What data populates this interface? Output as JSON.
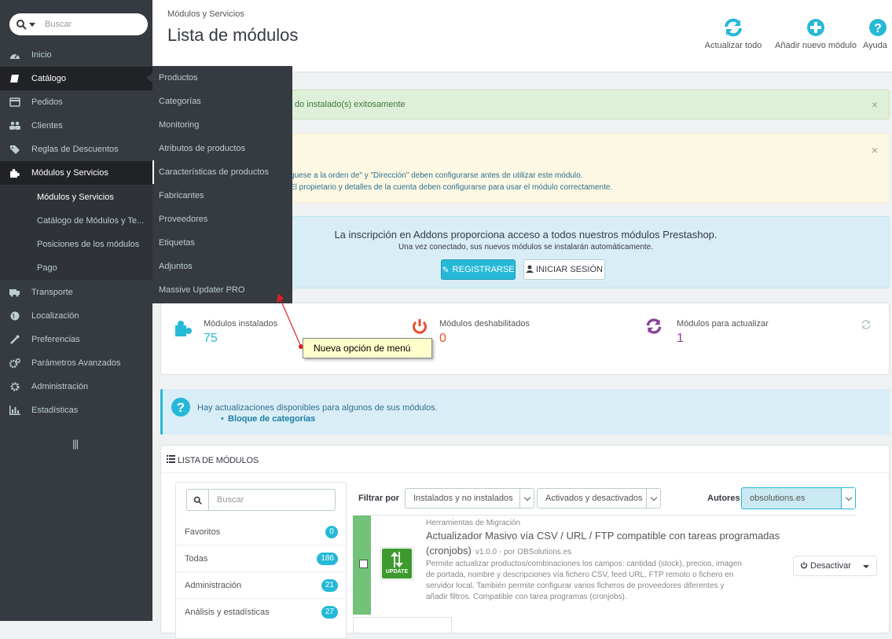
{
  "sidebar": {
    "search_placeholder": "Buscar",
    "items": [
      {
        "label": "Inicio",
        "icon": "dashboard-icon"
      },
      {
        "label": "Catálogo",
        "icon": "book-icon"
      },
      {
        "label": "Pedidos",
        "icon": "credit-card-icon"
      },
      {
        "label": "Clientes",
        "icon": "users-icon"
      },
      {
        "label": "Reglas de Descuentos",
        "icon": "tag-icon"
      },
      {
        "label": "Módulos y Servicios",
        "icon": "puzzle-icon"
      },
      {
        "label": "Transporte",
        "icon": "truck-icon"
      },
      {
        "label": "Localización",
        "icon": "globe-icon"
      },
      {
        "label": "Preferencias",
        "icon": "wrench-icon"
      },
      {
        "label": "Parámetros Avanzados",
        "icon": "cogs-icon"
      },
      {
        "label": "Administración",
        "icon": "cog-icon"
      },
      {
        "label": "Estadísticas",
        "icon": "bar-chart-icon"
      }
    ],
    "submenu": [
      {
        "label": "Módulos y Servicios"
      },
      {
        "label": "Catálogo de Módulos y Te..."
      },
      {
        "label": "Posiciones de los módulos"
      },
      {
        "label": "Pago"
      }
    ],
    "collapse_icon": "|||"
  },
  "flyout": {
    "items": [
      {
        "label": "Productos"
      },
      {
        "label": "Categorías"
      },
      {
        "label": "Monitoring"
      },
      {
        "label": "Atributos de productos"
      },
      {
        "label": "Características de productos"
      },
      {
        "label": "Fabricantes"
      },
      {
        "label": "Proveedores"
      },
      {
        "label": "Etiquetas"
      },
      {
        "label": "Adjuntos"
      },
      {
        "label": "Massive Updater PRO"
      }
    ]
  },
  "header": {
    "breadcrumb": "Módulos y Servicios",
    "title": "Lista de módulos",
    "toolbar": [
      {
        "label": "Actualizar todo",
        "icon": "refresh-icon"
      },
      {
        "label": "Añadir nuevo módulo",
        "icon": "plus-circle-icon"
      },
      {
        "label": "Ayuda",
        "icon": "question-circle-icon"
      }
    ]
  },
  "alerts": {
    "success_text": "do instalado(s) exitosamente",
    "warning_line1": "guese a la orden de\" y \"Dirección\" deben configurarse antes de utilizar este módulo.",
    "warning_line2": "El propietario y detalles de la cuenta deben configurarse para usar el módulo correctamente.",
    "close": "×"
  },
  "addons": {
    "title": "La inscripción en Addons proporciona acceso a todos nuestros módulos Prestashop.",
    "subtitle": "Una vez conectado, sus nuevos módulos se instalarán automáticamente.",
    "register_label": "REGISTRARSE",
    "login_label": "INICIAR SESIÓN"
  },
  "kpis": [
    {
      "label": "Módulos instalados",
      "value": "75"
    },
    {
      "label": "Módulos deshabilitados",
      "value": "0"
    },
    {
      "label": "Módulos para actualizar",
      "value": "1"
    }
  ],
  "tooltip": "Nueva opción de menú",
  "updates": {
    "text": "Hay actualizaciones disponibles para algunos de sus módulos.",
    "item": "Bloque de categorías"
  },
  "modules_panel": {
    "heading": "LISTA DE MÓDULOS",
    "search_placeholder": "Buscar",
    "categories": [
      {
        "label": "Favoritos",
        "count": "0"
      },
      {
        "label": "Todas",
        "count": "186"
      },
      {
        "label": "Administración",
        "count": "21"
      },
      {
        "label": "Análisis y estadísticas",
        "count": "27"
      }
    ],
    "filter_label": "Filtrar por",
    "filter_install": "Instalados y no instalados",
    "filter_enable": "Activados y desactivados",
    "authors_label": "Autores",
    "authors_value": "obsolutions.es"
  },
  "module": {
    "category": "Herramientas de Migración",
    "name_line1": "Actualizador Masivo vía CSV / URL / FTP compatible con tareas programadas",
    "name_line2": "(cronjobs)",
    "version": "v1.0.0 - por OBSolutions.es",
    "desc_line1": "Permite actualizar productos/combinaciones los campos: cantidad (stock), precios, imagen",
    "desc_line2": "de portada, nombre y descripciones vía fichero CSV, feed URL, FTP remoto o fichero en",
    "desc_line3": "servidor local. También permite configurar varios ficheros de proveedores diferentes y",
    "desc_line4": "añadir filtros. Compatible con tarea programas (cronjobs).",
    "icon_label": "UPDATE",
    "action_label": "Desactivar"
  },
  "colors": {
    "sidebar_bg": "#363a41",
    "accent": "#25b9d7",
    "success_bg": "#dff0d8",
    "warning_bg": "#fcf8e3",
    "info_bg": "#d9edf7",
    "danger": "#e84e2e",
    "purple": "#8a3f9a",
    "module_green": "#72c279"
  }
}
